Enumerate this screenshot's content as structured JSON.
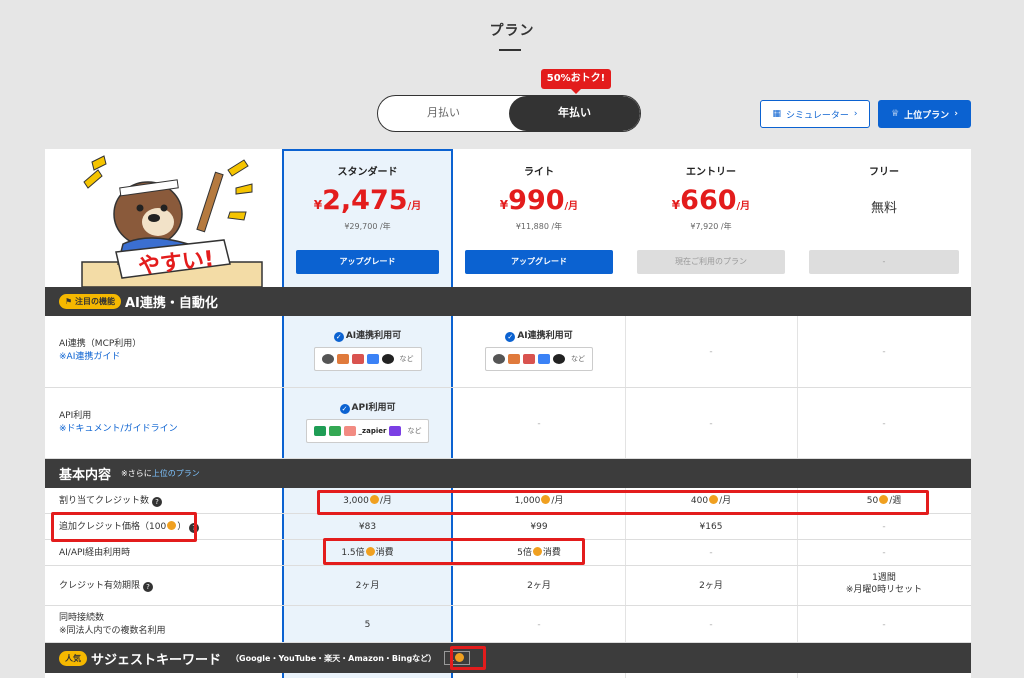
{
  "page_title": "プラン",
  "discount_badge": "50%おトク!",
  "billing": {
    "monthly": "月払い",
    "yearly": "年払い"
  },
  "buttons": {
    "simulator": "シミュレーター",
    "upper_plan": "上位プラン"
  },
  "mascot_sign": "やすい!",
  "plans": [
    {
      "name": "スタンダード",
      "yen": "¥",
      "price": "2,475",
      "unit": "/月",
      "annual": "¥29,700 /年",
      "button": "アップグレード"
    },
    {
      "name": "ライト",
      "yen": "¥",
      "price": "990",
      "unit": "/月",
      "annual": "¥11,880 /年",
      "button": "アップグレード"
    },
    {
      "name": "エントリー",
      "yen": "¥",
      "price": "660",
      "unit": "/月",
      "annual": "¥7,920 /年",
      "button": "現在ご利用のプラン"
    },
    {
      "name": "フリー",
      "price_text": "無料",
      "button": "-"
    }
  ],
  "sec_ai": {
    "tag": "注目の機能",
    "title": "AI連携・自動化"
  },
  "row_mcp": {
    "label": "AI連携（MCP利用）",
    "link": "※AI連携ガイド",
    "std": "AI連携利用可",
    "lite": "AI連携利用可",
    "etc": "など",
    "dash": "-"
  },
  "row_api": {
    "label": "API利用",
    "link": "※ドキュメント/ガイドライン",
    "std": "API利用可",
    "zapier": "_zapier",
    "etc": "など",
    "dash": "-"
  },
  "sec_basic": {
    "title": "基本内容",
    "note": "※さらに",
    "link": "上位のプラン"
  },
  "credits": {
    "label": "割り当てクレジット数",
    "std": "3,000",
    "std_unit": "/月",
    "lite": "1,000",
    "lite_unit": "/月",
    "entry": "400",
    "entry_unit": "/月",
    "free": "50",
    "free_unit": "/週"
  },
  "extra_price": {
    "label": "追加クレジット価格（100",
    "label_end": "）",
    "std": "¥83",
    "lite": "¥99",
    "entry": "¥165",
    "free": "-"
  },
  "api_usage": {
    "label": "AI/API経由利用時",
    "std": "1.5倍",
    "std_unit": "消費",
    "lite": "5倍",
    "lite_unit": "消費",
    "entry": "-",
    "free": "-"
  },
  "validity": {
    "label": "クレジット有効期限",
    "std": "2ヶ月",
    "lite": "2ヶ月",
    "entry": "2ヶ月",
    "free": "1週間",
    "free_note": "※月曜0時リセット"
  },
  "concurrent": {
    "label": "同時接続数",
    "note": "※同法人内での複数名利用",
    "std": "5",
    "lite": "-",
    "entry": "-",
    "free": "-"
  },
  "sec_suggest": {
    "tag": "人気",
    "title": "サジェストキーワード",
    "note": "（Google・YouTube・楽天・Amazon・Bingなど）",
    "cost": "1"
  },
  "colors": {
    "accent": "#0b62d1",
    "price_red": "#e31c1c",
    "dark_bar": "#3c3c3c",
    "coin": "#f0a020"
  }
}
